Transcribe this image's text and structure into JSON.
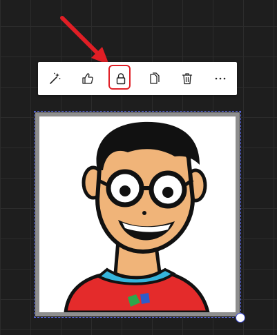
{
  "toolbar": {
    "buttons": [
      {
        "id": "magic",
        "icon": "magic-wand-icon"
      },
      {
        "id": "like",
        "icon": "thumbs-up-icon"
      },
      {
        "id": "lock",
        "icon": "lock-icon",
        "highlighted": true
      },
      {
        "id": "duplicate",
        "icon": "copy-icon"
      },
      {
        "id": "delete",
        "icon": "trash-icon"
      },
      {
        "id": "more",
        "icon": "more-horizontal-icon"
      }
    ]
  },
  "annotation": {
    "color": "#e01e25",
    "target": "lock"
  },
  "selection": {
    "color": "#5a6ae6"
  },
  "colors": {
    "canvas_bg": "#1e1e1e",
    "frame": "#8e8e8e"
  }
}
